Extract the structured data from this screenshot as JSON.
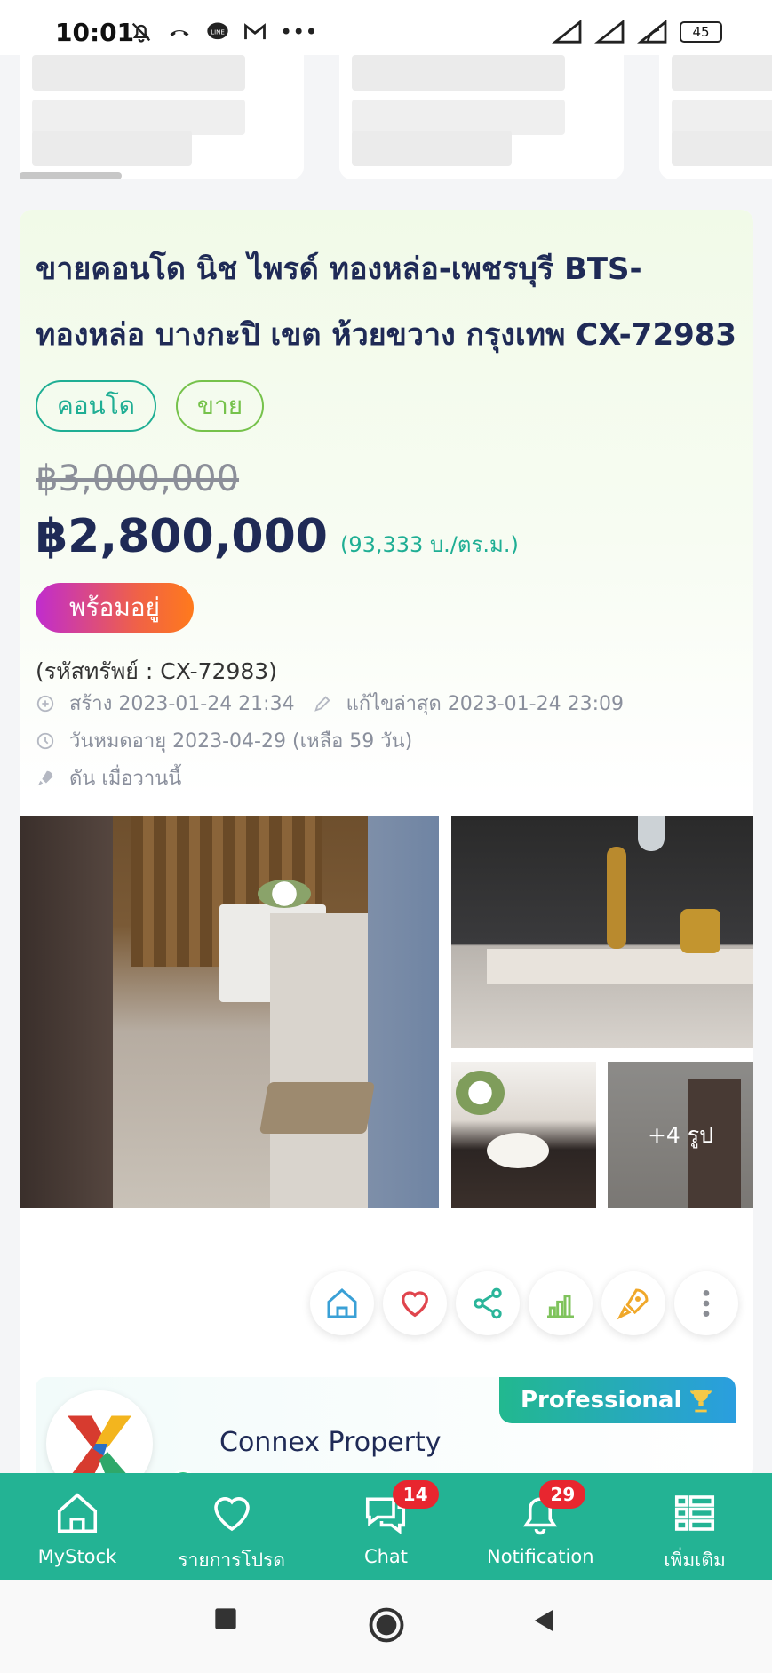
{
  "status_bar": {
    "time": "10:01",
    "battery": "45",
    "icons": [
      "mute-bell-icon",
      "missed-call-icon",
      "line-icon",
      "gmail-icon",
      "more-dots-icon",
      "signal-icon",
      "signal-icon",
      "wifi-icon",
      "battery-icon"
    ]
  },
  "listing": {
    "title": "ขายคอนโด นิช ไพรด์ ทองหล่อ-เพชรบุรี BTS-ทองหล่อ บางกะปิ เขต ห้วยขวาง กรุงเทพ CX-72983",
    "tag_type": "คอนโด",
    "tag_deal": "ขาย",
    "old_price": "฿3,000,000",
    "price": "฿2,800,000",
    "price_per_unit": "(93,333 บ./ตร.ม.)",
    "status": "พร้อมอยู่",
    "code": "(รหัสทรัพย์ : CX-72983)",
    "created": "สร้าง 2023-01-24 21:34",
    "edited": "แก้ไขล่าสุด 2023-01-24 23:09",
    "expires": "วันหมดอายุ 2023-04-29  (เหลือ 59 วัน)",
    "boosted": "ดัน เมื่อวานนี้",
    "more_photos": "+4 รูป"
  },
  "agent": {
    "name": "Connex Property",
    "badge": "Professional"
  },
  "bottom_nav": [
    {
      "label": "MyStock",
      "icon": "home-icon"
    },
    {
      "label": "รายการโปรด",
      "icon": "heart-icon"
    },
    {
      "label": "Chat",
      "icon": "chat-icon",
      "badge": "14"
    },
    {
      "label": "Notification",
      "icon": "bell-icon",
      "badge": "29"
    },
    {
      "label": "เพิ่มเติม",
      "icon": "menu-grid-icon"
    }
  ],
  "colors": {
    "brand_green": "#23b394",
    "title_navy": "#1f2a56",
    "badge_red": "#e8262f"
  }
}
